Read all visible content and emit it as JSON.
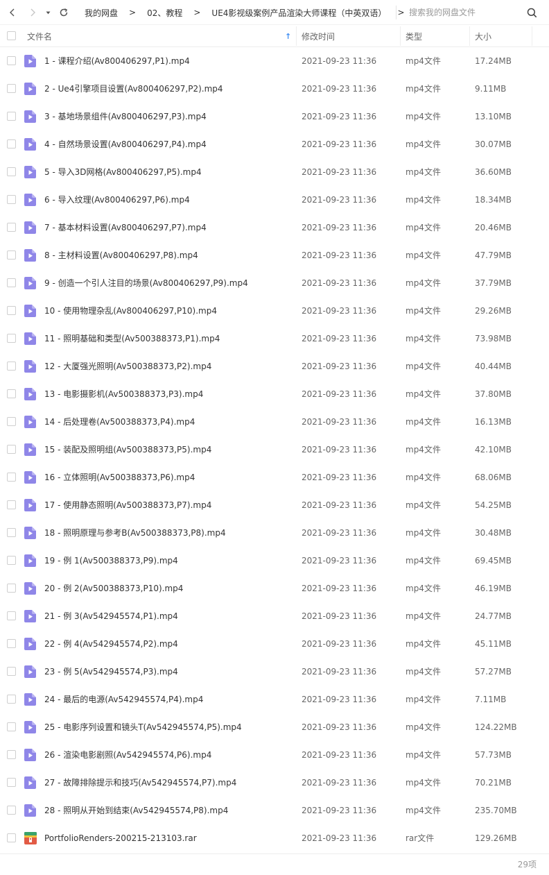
{
  "nav": {
    "back_icon": "chevron-left-icon",
    "forward_icon": "chevron-right-icon",
    "history_icon": "caret-down-icon",
    "refresh_icon": "refresh-icon"
  },
  "breadcrumb": {
    "items": [
      "我的网盘",
      "02、教程",
      "UE4影视级案例产品渲染大师课程（中英双语）"
    ],
    "separator": ">"
  },
  "search": {
    "placeholder": "搜索我的网盘文件",
    "icon": "search-icon"
  },
  "columns": {
    "name": "文件名",
    "modified": "修改时间",
    "type": "类型",
    "size": "大小",
    "sort_indicator": "↑"
  },
  "colors": {
    "video_icon": "#8f86e8",
    "sort_arrow": "#3f8ef3",
    "archive_icon": "#e25b45"
  },
  "files": [
    {
      "name": "1 - 课程介绍(Av800406297,P1).mp4",
      "date": "2021-09-23 11:36",
      "type": "mp4文件",
      "size": "17.24MB",
      "icon": "video-file-icon"
    },
    {
      "name": "2 - Ue4引擎项目设置(Av800406297,P2).mp4",
      "date": "2021-09-23 11:36",
      "type": "mp4文件",
      "size": "9.11MB",
      "icon": "video-file-icon"
    },
    {
      "name": "3 - 基地场景组件(Av800406297,P3).mp4",
      "date": "2021-09-23 11:36",
      "type": "mp4文件",
      "size": "13.10MB",
      "icon": "video-file-icon"
    },
    {
      "name": "4 - 自然场景设置(Av800406297,P4).mp4",
      "date": "2021-09-23 11:36",
      "type": "mp4文件",
      "size": "30.07MB",
      "icon": "video-file-icon"
    },
    {
      "name": "5 - 导入3D网格(Av800406297,P5).mp4",
      "date": "2021-09-23 11:36",
      "type": "mp4文件",
      "size": "36.60MB",
      "icon": "video-file-icon"
    },
    {
      "name": "6 - 导入纹理(Av800406297,P6).mp4",
      "date": "2021-09-23 11:36",
      "type": "mp4文件",
      "size": "18.34MB",
      "icon": "video-file-icon"
    },
    {
      "name": "7 - 基本材料设置(Av800406297,P7).mp4",
      "date": "2021-09-23 11:36",
      "type": "mp4文件",
      "size": "20.46MB",
      "icon": "video-file-icon"
    },
    {
      "name": "8 - 主材料设置(Av800406297,P8).mp4",
      "date": "2021-09-23 11:36",
      "type": "mp4文件",
      "size": "47.79MB",
      "icon": "video-file-icon"
    },
    {
      "name": "9 - 创造一个引人注目的场景(Av800406297,P9).mp4",
      "date": "2021-09-23 11:36",
      "type": "mp4文件",
      "size": "37.79MB",
      "icon": "video-file-icon"
    },
    {
      "name": "10 - 使用物理杂乱(Av800406297,P10).mp4",
      "date": "2021-09-23 11:36",
      "type": "mp4文件",
      "size": "29.26MB",
      "icon": "video-file-icon"
    },
    {
      "name": "11 - 照明基础和类型(Av500388373,P1).mp4",
      "date": "2021-09-23 11:36",
      "type": "mp4文件",
      "size": "73.98MB",
      "icon": "video-file-icon"
    },
    {
      "name": "12 - 大厦强光照明(Av500388373,P2).mp4",
      "date": "2021-09-23 11:36",
      "type": "mp4文件",
      "size": "40.44MB",
      "icon": "video-file-icon"
    },
    {
      "name": "13 - 电影摄影机(Av500388373,P3).mp4",
      "date": "2021-09-23 11:36",
      "type": "mp4文件",
      "size": "37.80MB",
      "icon": "video-file-icon"
    },
    {
      "name": "14 - 后处理卷(Av500388373,P4).mp4",
      "date": "2021-09-23 11:36",
      "type": "mp4文件",
      "size": "16.13MB",
      "icon": "video-file-icon"
    },
    {
      "name": "15 - 装配及照明组(Av500388373,P5).mp4",
      "date": "2021-09-23 11:36",
      "type": "mp4文件",
      "size": "42.10MB",
      "icon": "video-file-icon"
    },
    {
      "name": "16 - 立体照明(Av500388373,P6).mp4",
      "date": "2021-09-23 11:36",
      "type": "mp4文件",
      "size": "68.06MB",
      "icon": "video-file-icon"
    },
    {
      "name": "17 - 使用静态照明(Av500388373,P7).mp4",
      "date": "2021-09-23 11:36",
      "type": "mp4文件",
      "size": "54.25MB",
      "icon": "video-file-icon"
    },
    {
      "name": "18 - 照明原理与参考B(Av500388373,P8).mp4",
      "date": "2021-09-23 11:36",
      "type": "mp4文件",
      "size": "30.48MB",
      "icon": "video-file-icon"
    },
    {
      "name": "19 - 例 1(Av500388373,P9).mp4",
      "date": "2021-09-23 11:36",
      "type": "mp4文件",
      "size": "69.45MB",
      "icon": "video-file-icon"
    },
    {
      "name": "20 - 例 2(Av500388373,P10).mp4",
      "date": "2021-09-23 11:36",
      "type": "mp4文件",
      "size": "46.19MB",
      "icon": "video-file-icon"
    },
    {
      "name": "21 - 例 3(Av542945574,P1).mp4",
      "date": "2021-09-23 11:36",
      "type": "mp4文件",
      "size": "24.77MB",
      "icon": "video-file-icon"
    },
    {
      "name": "22 - 例 4(Av542945574,P2).mp4",
      "date": "2021-09-23 11:36",
      "type": "mp4文件",
      "size": "45.11MB",
      "icon": "video-file-icon"
    },
    {
      "name": "23 - 例 5(Av542945574,P3).mp4",
      "date": "2021-09-23 11:36",
      "type": "mp4文件",
      "size": "57.27MB",
      "icon": "video-file-icon"
    },
    {
      "name": "24 - 最后的电源(Av542945574,P4).mp4",
      "date": "2021-09-23 11:36",
      "type": "mp4文件",
      "size": "7.11MB",
      "icon": "video-file-icon"
    },
    {
      "name": "25 - 电影序列设置和镜头T(Av542945574,P5).mp4",
      "date": "2021-09-23 11:36",
      "type": "mp4文件",
      "size": "124.22MB",
      "icon": "video-file-icon"
    },
    {
      "name": "26 - 渲染电影剧照(Av542945574,P6).mp4",
      "date": "2021-09-23 11:36",
      "type": "mp4文件",
      "size": "57.73MB",
      "icon": "video-file-icon"
    },
    {
      "name": "27 - 故障排除提示和技巧(Av542945574,P7).mp4",
      "date": "2021-09-23 11:36",
      "type": "mp4文件",
      "size": "70.21MB",
      "icon": "video-file-icon"
    },
    {
      "name": "28 - 照明从开始到结束(Av542945574,P8).mp4",
      "date": "2021-09-23 11:36",
      "type": "mp4文件",
      "size": "235.70MB",
      "icon": "video-file-icon"
    },
    {
      "name": "PortfolioRenders-200215-213103.rar",
      "date": "2021-09-23 11:36",
      "type": "rar文件",
      "size": "129.26MB",
      "icon": "archive-file-icon"
    }
  ],
  "footer": {
    "count": "29项"
  }
}
